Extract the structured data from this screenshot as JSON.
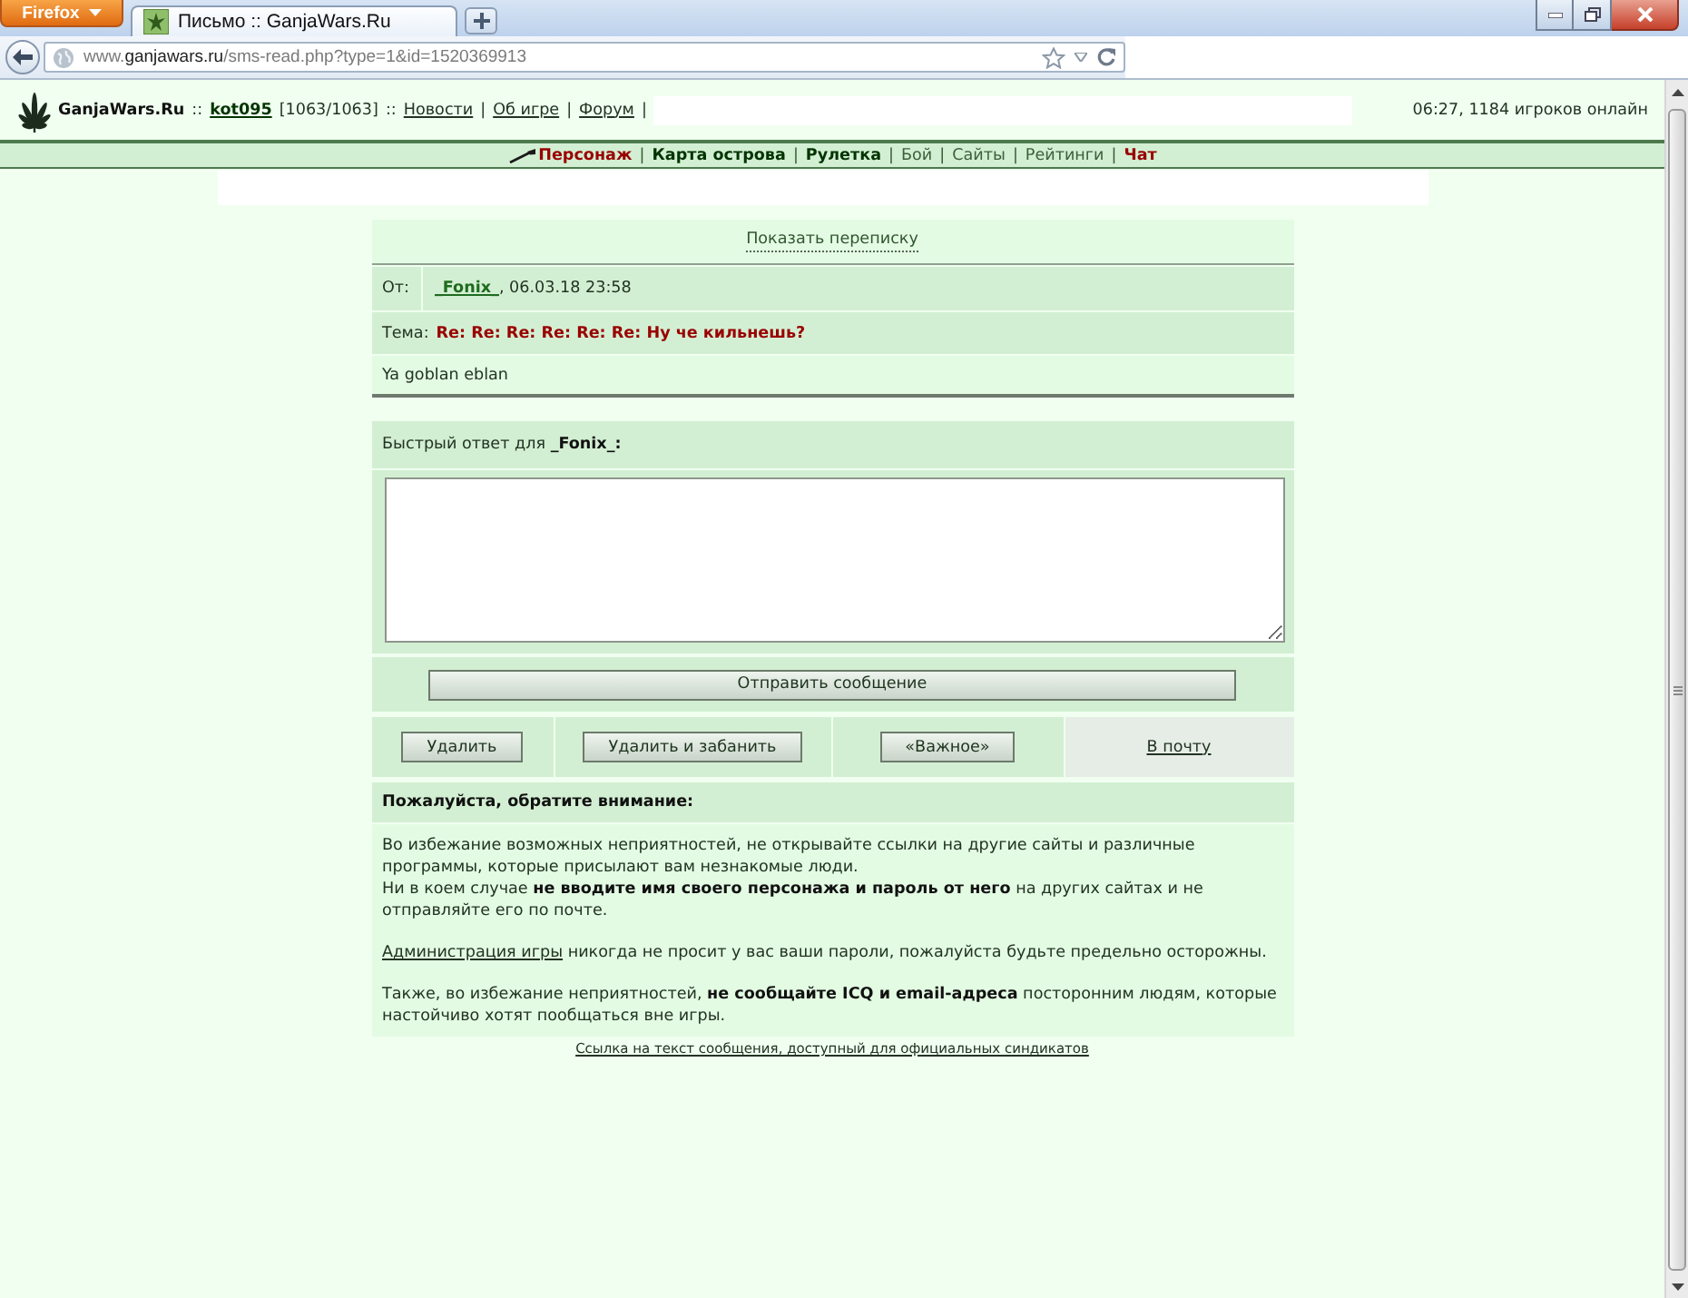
{
  "browser": {
    "menu_button": "Firefox",
    "tab_title": "Письмо :: GanjaWars.Ru",
    "url": {
      "prefix": "www.",
      "domain": "ganjawars.ru",
      "path": "/sms-read.php?type=1&id=1520369913"
    }
  },
  "top_bar": {
    "items": [
      {
        "kind": "brand",
        "text": "GanjaWars.Ru"
      },
      {
        "kind": "separator",
        "text": "::"
      },
      {
        "kind": "user",
        "text": "kot095"
      },
      {
        "kind": "plain",
        "text": "[1063/1063]"
      },
      {
        "kind": "separator",
        "text": "::"
      },
      {
        "kind": "link",
        "text": "Новости"
      },
      {
        "kind": "separator",
        "text": "|"
      },
      {
        "kind": "link",
        "text": "Об игре"
      },
      {
        "kind": "separator",
        "text": "|"
      },
      {
        "kind": "link",
        "text": "Форум"
      },
      {
        "kind": "separator",
        "text": "|"
      }
    ],
    "status": "06:27, 1184 игроков онлайн"
  },
  "nav": [
    {
      "kind": "link",
      "text": "Персонаж",
      "bold": true,
      "color": "#990000"
    },
    {
      "kind": "separator",
      "text": "|"
    },
    {
      "kind": "link",
      "text": "Карта острова",
      "bold": true,
      "color": "#003300"
    },
    {
      "kind": "separator",
      "text": "|"
    },
    {
      "kind": "link",
      "text": "Рулетка",
      "bold": true,
      "color": "#003300"
    },
    {
      "kind": "separator",
      "text": "|"
    },
    {
      "kind": "link",
      "text": "Бой",
      "bold": false,
      "color": "#3b5e3b"
    },
    {
      "kind": "separator",
      "text": "|"
    },
    {
      "kind": "link",
      "text": "Сайты",
      "bold": false,
      "color": "#3b5e3b"
    },
    {
      "kind": "separator",
      "text": "|"
    },
    {
      "kind": "link",
      "text": "Рейтинги",
      "bold": false,
      "color": "#3b5e3b"
    },
    {
      "kind": "separator",
      "text": "|"
    },
    {
      "kind": "link",
      "text": "Чат",
      "bold": true,
      "color": "#990000"
    }
  ],
  "message": {
    "show_thread": "Показать переписку",
    "from_label": "От:",
    "sender": "_Fonix_",
    "date": ", 06.03.18 23:58",
    "subject_label": "Тема:",
    "subject": "Re: Re: Re: Re: Re: Re: Ну че кильнешь?",
    "body": "Ya goblan eblan"
  },
  "reply": {
    "label": "Быстрый ответ для **_Fonix_:**",
    "send_button": "Отправить сообщение"
  },
  "actions": [
    {
      "kind": "button",
      "label": "Удалить"
    },
    {
      "kind": "button",
      "label": "Удалить и забанить"
    },
    {
      "kind": "button",
      "label": "«Важное»"
    },
    {
      "kind": "link",
      "label": "В почту"
    }
  ],
  "notice": {
    "title": "Пожалуйста, обратите внимание:",
    "paragraphs": [
      [
        {
          "text": "Во избежание возможных неприятностей, не открывайте ссылки на другие сайты и различные программы, которые присылают вам незнакомые люди."
        },
        {
          "text": "Ни в коем случае **не вводите имя своего персонажа и пароль от него** на других сайтах и не отправляйте его по почте."
        }
      ],
      [
        {
          "link": "Администрация игры",
          "text": "никогда не просит у вас ваши пароли, пожалуйста будьте предельно осторожны."
        }
      ],
      [
        {
          "text": "Также, во избежание неприятностей, **не сообщайте ICQ и email-адреса** посторонним людям, которые настойчиво хотят пообщаться вне игры."
        }
      ]
    ]
  },
  "footer_link": "Ссылка на текст сообщения, доступный для официальных синдикатов"
}
